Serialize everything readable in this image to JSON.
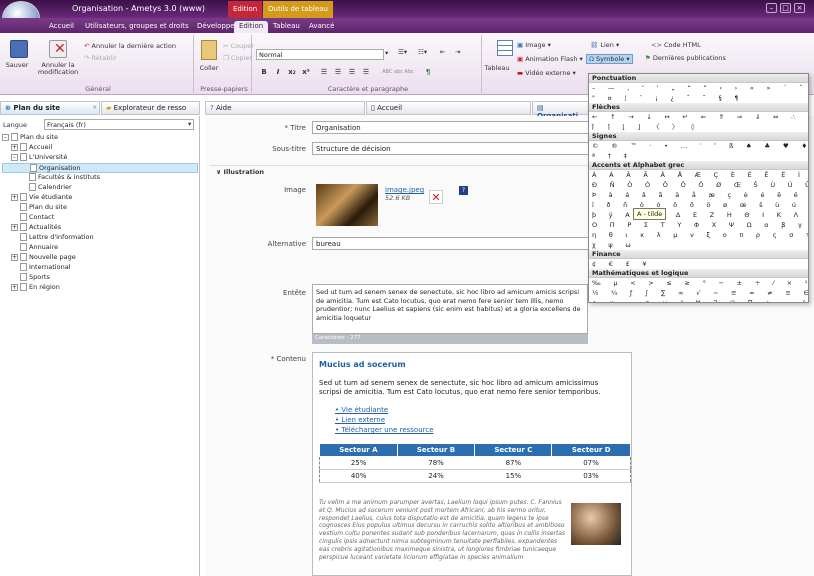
{
  "window": {
    "title": "Organisation - Ametys 3.0 (www)",
    "ctx_edition": "Edition",
    "ctx_tableau": "Outils de tableau"
  },
  "menu": {
    "tabs": [
      "Accueil",
      "Utilisateurs, groupes et droits",
      "Développeur",
      "Edition",
      "Tableau",
      "Avancé"
    ]
  },
  "ribbon": {
    "save": "Sauver",
    "cancel": "Annuler la",
    "cancel2": "modification",
    "undo": "Annuler la dernière action",
    "redo": "Rétablir",
    "group_general": "Général",
    "paste": "Coller",
    "cut": "Couper",
    "copy": "Copier",
    "group_clipboard": "Presse-papiers",
    "style_value": "Normal",
    "group_format": "Caractère et paragraphe",
    "tableau": "Tableau",
    "image": "Image ▾",
    "flash": "Animation Flash ▾",
    "video": "Vidéo externe ▾",
    "lien": "Lien ▾",
    "symbole": "Symbole ▾",
    "code_html": "Code HTML",
    "dernieres": "Dernières publications"
  },
  "left": {
    "tab1": "Plan du site",
    "tab2": "Explorateur de resso",
    "lang_label": "Langue",
    "lang_value": "Français (fr)",
    "tree": [
      {
        "t": "Plan du site",
        "lvl": 0,
        "ex": "-"
      },
      {
        "t": "Accueil",
        "lvl": 1,
        "ex": "+"
      },
      {
        "t": "L'Université",
        "lvl": 1,
        "ex": "-"
      },
      {
        "t": "Organisation",
        "lvl": 2,
        "ex": "",
        "sel": true
      },
      {
        "t": "Facultés & instituts",
        "lvl": 2,
        "ex": ""
      },
      {
        "t": "Calendrier",
        "lvl": 2,
        "ex": ""
      },
      {
        "t": "Vie étudiante",
        "lvl": 1,
        "ex": "+"
      },
      {
        "t": "Plan du site",
        "lvl": 1,
        "ex": ""
      },
      {
        "t": "Contact",
        "lvl": 1,
        "ex": ""
      },
      {
        "t": "Actualités",
        "lvl": 1,
        "ex": "+"
      },
      {
        "t": "Lettre d'information",
        "lvl": 1,
        "ex": ""
      },
      {
        "t": "Annuaire",
        "lvl": 1,
        "ex": ""
      },
      {
        "t": "Nouvelle page",
        "lvl": 1,
        "ex": "+"
      },
      {
        "t": "International",
        "lvl": 1,
        "ex": ""
      },
      {
        "t": "Sports",
        "lvl": 1,
        "ex": ""
      },
      {
        "t": "En région",
        "lvl": 1,
        "ex": "+"
      }
    ]
  },
  "editor": {
    "tab_aide": "Aide",
    "tab_accueil": "Accueil",
    "tab_org": "Organisati",
    "titre_label": "* Titre",
    "titre": "Organisation",
    "soustitre_label": "Sous-titre",
    "soustitre": "Structure de décision",
    "illustration": "Illustration",
    "image_label": "Image",
    "image_file": "image.jpeg",
    "image_size": "52.6 KB",
    "alt_label": "Alternative",
    "alt": "bureau",
    "entete_label": "Entête",
    "entete": "Sed ut tum ad senem senex de senectute, sic hoc libro ad amicum amicis scripsi de amicitia. Tum est Cato locutus, quo erat nemo fere senior tem illis, nemo prudentior; nunc Laelius et sapiens (sic enim est habitus) et a gloria excellens de amicitia loquetur",
    "chars": "Caractères : 277",
    "contenu_label": "* Contenu",
    "heading": "Mucius ad socerum",
    "para": "Sed ut tum ad senem senex de senectute, sic hoc libro ad amicum amicissimus scripsi de amicitia. Tum est Cato locutus, quo erat nemo fere senior temporibus.",
    "links": [
      "Vie étudiante",
      "Lien externe",
      "Télécharger une ressource"
    ],
    "table_head": [
      "Secteur A",
      "Secteur B",
      "Secteur C",
      "Secteur D"
    ],
    "table_rows": [
      [
        "25%",
        "78%",
        "87%",
        "07%"
      ],
      [
        "40%",
        "24%",
        "15%",
        "03%"
      ]
    ],
    "italic": "Tu velim a me animum parumper avertas, Laelium loqui ipsum putes. C. Fannius et Q. Mucius ad socerum veniunt post mortem Africani; ab his sermo oritur, respondet Laelius, cuius tota disputatio est de amicitia, quam legens te ipse cognosces Eius populus ultimus decursu in carruchis solito altioribus et ambitioso vestium cultu ponentes sudant sub ponderibus lacernarum, quas in collis insertas cingulis ipsis adnectunt nimia subtegminum tenuitate perflabiles, expandentes eas crebris agitationibus maximeque sinistra, ut longiores fimbriae tunicaeque perspicue luceant varietate liciorum effigiatae in species animalium"
  },
  "charmap": {
    "tooltip": "A - tilde",
    "sections": [
      {
        "h": "Ponctuation",
        "rows": [
          "– — ‚ ‘ ’ „ “ ” ‹ › « » ´ ˆ ¨ ¸ ‐ – —",
          "\" ¤ ¦ ¨ ¡ ¿ ˆ ˜ § ¶"
        ]
      },
      {
        "h": "Flèches",
        "rows": [
          "← ↑ → ↓ ↔ ↵ ⇐ ⇑ ⇒ ⇓ ⇔ ∴ ⊕ ⊗ ⊥ ·",
          "⌈ ⌉ ⌊ ⌋ 〈 〉 ◊"
        ]
      },
      {
        "h": "Signes",
        "rows": [
          "© ® ™ · • … ′ ″ ß ♠ ♣ ♥ ♦ ‾ ¸ °",
          "ª † ‡"
        ]
      },
      {
        "h": "Accents et Alphabet grec",
        "rows": [
          "À Á Â Ã Ä Å Æ Ç È É Ê Ë Ì Í Î Ï",
          "Ð Ñ Ò Ó Ô Õ Ö Ø Œ Š Ù Ú Û Ü Ý Ÿ",
          "Þ à á â ã ä å æ ç è é ê ë ì í î ï",
          "ï ð ñ ò ó ô õ ö ø œ š ù ú û ü ý",
          "þ ÿ Α Β Γ Δ Ε Ζ Η Θ Ι Κ Λ Μ Ν Ξ",
          "Ο Π Ρ Σ Τ Υ Φ Χ Ψ Ω α β γ δ ε ζ",
          "η θ ι κ λ μ ν ξ ο π ρ ς σ τ υ φ",
          "χ ψ ω"
        ]
      },
      {
        "h": "Finance",
        "rows": [
          "¢ € £ ¥"
        ]
      },
      {
        "h": "Mathématiques et logique",
        "rows": [
          "‰ µ < > ≤ ≥ ° − ± ÷ ⁄ × ¹ ² ³ ¼",
          "½ ¾ ƒ ∫ ∑ ∞ √ ∼ ≅ ≈ ≠ ≡ ∈ ∉ ∋ ∏",
          "∧ ∨ ¬ ∩ ∪ ∂ ∀ ∃ ∅ ∇ ∗ ∝ ∠ ¬ ⊂ ⊃",
          "∂ ∇ ρ ∂ ⊂ ⊃ ⊆ ⊇"
        ]
      }
    ]
  },
  "colors": {
    "accent": "#6b2a7a",
    "link": "#1f5fa8",
    "table_head": "#2c6fb0"
  }
}
